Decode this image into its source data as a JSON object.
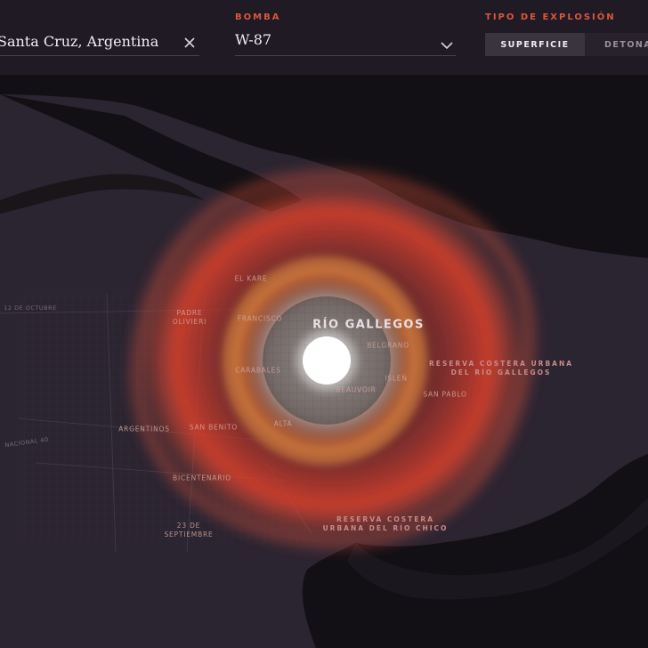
{
  "header": {
    "location": {
      "value": "Santa Cruz, Argentina",
      "clear_icon": "close-icon"
    },
    "bomb": {
      "label": "BOMBA",
      "value": "W-87",
      "dropdown_icon": "chevron-down-icon"
    },
    "explosion_type": {
      "label": "TIPO DE EXPLOSIÓN",
      "options": [
        "SUPERFICIE",
        "DETONAC"
      ],
      "selected": "SUPERFICIE"
    }
  },
  "map": {
    "city": "RÍO GALLEGOS",
    "neighborhoods": [
      "EL KARE",
      "PADRE OLIVIERI",
      "FRANCISCO",
      "CARABALES",
      "ARGENTINOS",
      "SAN BENITO",
      "BICENTENARIO",
      "23 DE SEPTIEMBRE",
      "BELGRANO",
      "BEAUVOIR",
      "ISLEÑ",
      "SAN PABLO",
      "ALTA"
    ],
    "streets": [
      "12 DE OCTUBRE",
      "NACIONAL 40"
    ],
    "parks": [
      "RESERVA COSTERA URBANA\nDEL RÍO GALLEGOS",
      "RESERVA COSTERA\nURBANA DEL RÍO CHICO"
    ]
  },
  "colors": {
    "accent": "#d9573b",
    "background": "#221c26",
    "land": "#2b2431",
    "water": "#131015",
    "fireball": "#ffffff",
    "thermal_ring": "#e5402a",
    "blast_ring": "#c6773a"
  }
}
